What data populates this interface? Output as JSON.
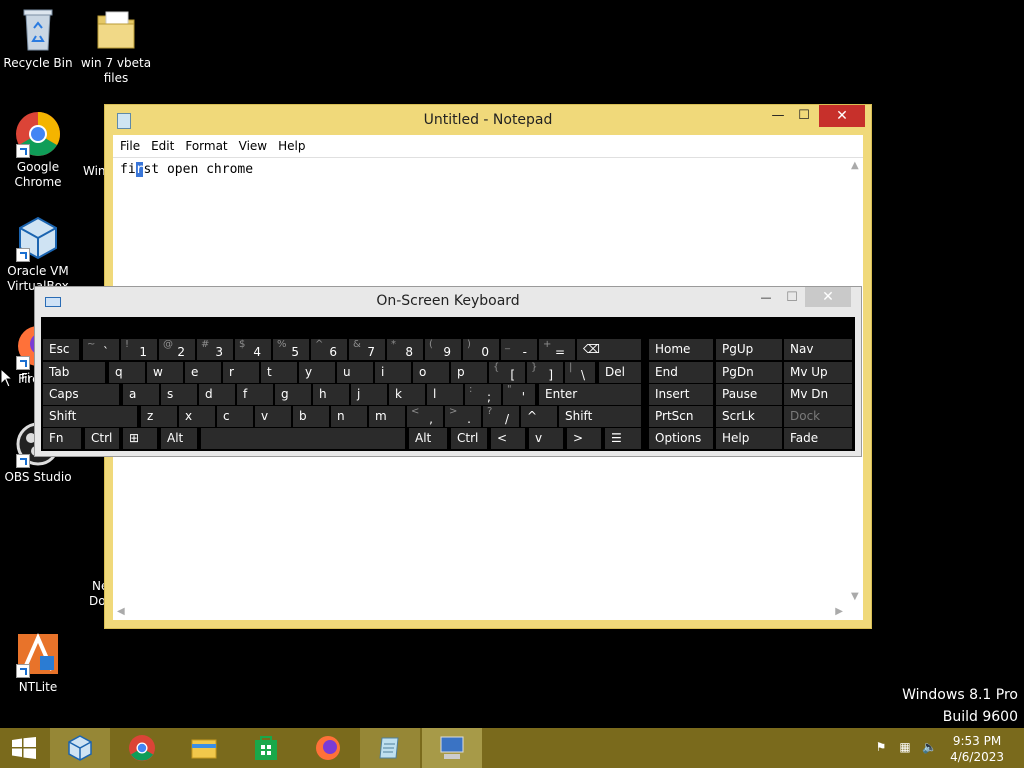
{
  "desktop": {
    "icons": [
      {
        "label": "Recycle Bin",
        "icon": "recycle-bin-icon"
      },
      {
        "label": "win 7 vbeta files",
        "icon": "folder-icon"
      },
      {
        "label": "Google Chrome",
        "icon": "chrome-icon"
      },
      {
        "label": "Oracle VM VirtualBox",
        "icon": "virtualbox-icon"
      },
      {
        "label": "Firefox",
        "icon": "firefox-icon"
      },
      {
        "label": "OBS Studio",
        "icon": "obs-icon"
      },
      {
        "label": "NTLite",
        "icon": "ntlite-icon"
      }
    ],
    "partial_labels": [
      "Win",
      "Fi",
      "Ne",
      "Do"
    ]
  },
  "notepad": {
    "title": "Untitled - Notepad",
    "minimize": "—",
    "maximize": "☐",
    "close": "✕",
    "menu": [
      "File",
      "Edit",
      "Format",
      "View",
      "Help"
    ],
    "text_before": "fi",
    "text_selected": "r",
    "text_after": "st open chrome"
  },
  "osk": {
    "title": "On-Screen Keyboard",
    "minimize": "—",
    "maximize": "☐",
    "close": "✕",
    "rows": [
      [
        {
          "main": "Esc"
        },
        {
          "shift": "~",
          "main": "`"
        },
        {
          "shift": "!",
          "main": "1"
        },
        {
          "shift": "@",
          "main": "2"
        },
        {
          "shift": "#",
          "main": "3"
        },
        {
          "shift": "$",
          "main": "4"
        },
        {
          "shift": "%",
          "main": "5"
        },
        {
          "shift": "^",
          "main": "6"
        },
        {
          "shift": "&",
          "main": "7"
        },
        {
          "shift": "*",
          "main": "8"
        },
        {
          "shift": "(",
          "main": "9"
        },
        {
          "shift": ")",
          "main": "0"
        },
        {
          "shift": "_",
          "main": "-"
        },
        {
          "shift": "+",
          "main": "="
        },
        {
          "main": "⌫"
        }
      ],
      [
        {
          "main": "Tab"
        },
        {
          "main": "q"
        },
        {
          "main": "w"
        },
        {
          "main": "e"
        },
        {
          "main": "r"
        },
        {
          "main": "t"
        },
        {
          "main": "y"
        },
        {
          "main": "u"
        },
        {
          "main": "i"
        },
        {
          "main": "o"
        },
        {
          "main": "p"
        },
        {
          "shift": "{",
          "main": "["
        },
        {
          "shift": "}",
          "main": "]"
        },
        {
          "shift": "|",
          "main": "\\"
        },
        {
          "main": "Del"
        }
      ],
      [
        {
          "main": "Caps"
        },
        {
          "main": "a"
        },
        {
          "main": "s"
        },
        {
          "main": "d"
        },
        {
          "main": "f"
        },
        {
          "main": "g"
        },
        {
          "main": "h"
        },
        {
          "main": "j"
        },
        {
          "main": "k"
        },
        {
          "main": "l"
        },
        {
          "shift": ":",
          "main": ";"
        },
        {
          "shift": "\"",
          "main": "'"
        },
        {
          "main": "Enter"
        }
      ],
      [
        {
          "main": "Shift"
        },
        {
          "main": "z"
        },
        {
          "main": "x"
        },
        {
          "main": "c"
        },
        {
          "main": "v"
        },
        {
          "main": "b"
        },
        {
          "main": "n"
        },
        {
          "main": "m"
        },
        {
          "shift": "<",
          "main": ","
        },
        {
          "shift": ">",
          "main": "."
        },
        {
          "shift": "?",
          "main": "/"
        },
        {
          "main": "^"
        },
        {
          "main": "Shift"
        }
      ],
      [
        {
          "main": "Fn"
        },
        {
          "main": "Ctrl"
        },
        {
          "main": "⊞"
        },
        {
          "main": "Alt"
        },
        {
          "main": ""
        },
        {
          "main": "Alt"
        },
        {
          "main": "Ctrl"
        },
        {
          "main": "<"
        },
        {
          "main": "v"
        },
        {
          "main": ">"
        },
        {
          "main": "☰"
        }
      ]
    ],
    "nav_keys": [
      [
        "Home",
        "PgUp",
        "Nav"
      ],
      [
        "End",
        "PgDn",
        "Mv Up"
      ],
      [
        "Insert",
        "Pause",
        "Mv Dn"
      ],
      [
        "PrtScn",
        "ScrLk",
        "Dock"
      ],
      [
        "Options",
        "Help",
        "Fade"
      ]
    ]
  },
  "watermark": {
    "line1": "Windows 8.1 Pro",
    "line2": "Build 9600"
  },
  "taskbar": {
    "items": [
      "start-icon",
      "virtualbox-icon",
      "chrome-icon",
      "file-explorer-icon",
      "store-icon",
      "firefox-icon",
      "notepad-icon",
      "osk-icon"
    ],
    "time": "9:53 PM",
    "date": "4/6/2023",
    "tray_icons": [
      "flag-icon",
      "network-icon",
      "speaker-icon"
    ]
  }
}
